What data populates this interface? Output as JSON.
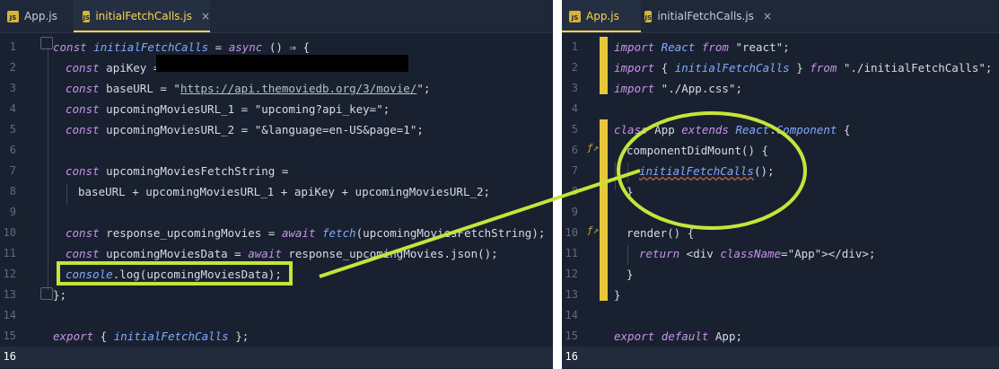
{
  "left_pane": {
    "tabs": [
      {
        "label": "App.js",
        "active": false,
        "icon": "js-file-icon"
      },
      {
        "label": "initialFetchCalls.js",
        "active": true,
        "icon": "js-file-icon",
        "close": "×"
      }
    ],
    "line_numbers": [
      "1",
      "2",
      "3",
      "4",
      "5",
      "6",
      "7",
      "8",
      "9",
      "10",
      "11",
      "12",
      "13",
      "14",
      "15",
      "16"
    ],
    "code": {
      "l1": {
        "kw": "const",
        "name": "initialFetchCalls",
        "eq": " = ",
        "async": "async",
        "rest": " () ⇒ {"
      },
      "l2": {
        "kw": "const",
        "rest": " apiKey = "
      },
      "l3": {
        "kw": "const",
        "rest": " baseURL = \"",
        "url": "https://api.themoviedb.org/3/movie/",
        "end": "\";"
      },
      "l4": {
        "kw": "const",
        "rest": " upcomingMoviesURL_1 = \"upcoming?api_key=\";"
      },
      "l5": {
        "kw": "const",
        "rest": " upcomingMoviesURL_2 = \"&language=en-US&page=1\";"
      },
      "l7": {
        "kw": "const",
        "rest": " upcomingMoviesFetchString ="
      },
      "l8": {
        "rest": "baseURL + upcomingMoviesURL_1 + apiKey + upcomingMoviesURL_2;"
      },
      "l10": {
        "kw": "const",
        "rest1": " response_upcomingMovies = ",
        "await": "await",
        "fetch": "fetch",
        "rest2": "(upcomingMoviesFetchString);"
      },
      "l11": {
        "kw": "const",
        "rest1": " upcomingMoviesData = ",
        "await": "await",
        "rest2": " response_upcomingMovies.json();"
      },
      "l12": {
        "console": "console",
        "rest": ".log(upcomingMoviesData);"
      },
      "l13": {
        "rest": "};"
      },
      "l15": {
        "kw": "export",
        "rest1": " { ",
        "name": "initialFetchCalls",
        "rest2": " };"
      }
    }
  },
  "right_pane": {
    "tabs": [
      {
        "label": "App.js",
        "active": true,
        "icon": "js-file-icon"
      },
      {
        "label": "initialFetchCalls.js",
        "active": false,
        "icon": "js-file-icon",
        "close": "×"
      }
    ],
    "line_numbers": [
      "1",
      "2",
      "3",
      "4",
      "5",
      "6",
      "7",
      "8",
      "9",
      "10",
      "11",
      "12",
      "13",
      "14",
      "15",
      "16"
    ],
    "code": {
      "l1": {
        "kw": "import",
        "name": " React ",
        "from": "from",
        "rest": " \"react\";"
      },
      "l2": {
        "kw": "import",
        "rest1": " { ",
        "name": "initialFetchCalls",
        "rest2": " } ",
        "from": "from",
        "rest3": " \"./initialFetchCalls\";"
      },
      "l3": {
        "kw": "import",
        "rest": " \"./App.css\";"
      },
      "l5": {
        "kw": "class",
        "rest1": " App ",
        "extends": "extends",
        "rest2": " React",
        "dot": ".",
        "comp": "Component",
        "rest3": " {"
      },
      "l6": {
        "rest": "componentDidMount() {"
      },
      "l7": {
        "name": "initialFetchCalls",
        "rest": "();"
      },
      "l8": {
        "rest": "}"
      },
      "l10": {
        "rest": "render() {"
      },
      "l11": {
        "kw": "return",
        "rest1": " <div ",
        "attr": "className",
        "rest2": "=\"App\"></div>;"
      },
      "l12": {
        "rest": "}"
      },
      "l13": {
        "rest": "}"
      },
      "l15": {
        "kw": "export",
        "kw2": "default",
        "rest": " App;"
      }
    },
    "gutter_icons": [
      "f-override-icon",
      "f-override-icon"
    ]
  },
  "colors": {
    "annotation": "#c5e53a",
    "background": "#192130",
    "keyword": "#c792ea",
    "function": "#82aaff",
    "gutter_bar": "#e8c83a"
  }
}
